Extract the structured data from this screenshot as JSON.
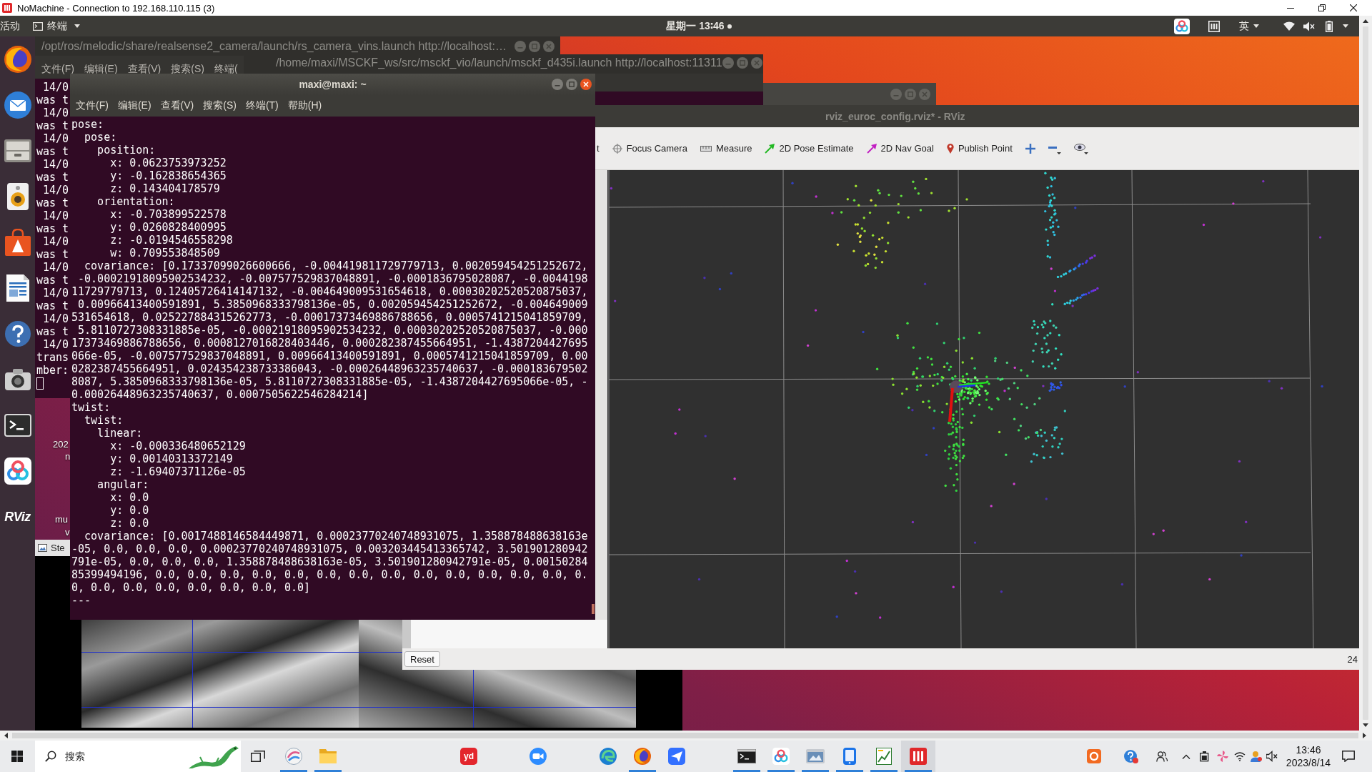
{
  "nomachine": {
    "title": "NoMachine - Connection to 192.168.110.115 (3)"
  },
  "top_bar": {
    "activities": "活动",
    "app_menu": "终端",
    "clock": "星期一 13∶46",
    "input_method": "英"
  },
  "dock": {
    "rviz_label": "RViz"
  },
  "desktop_labels": [
    "202",
    "n",
    "mu",
    "v"
  ],
  "launch_terminal": {
    "title": "/opt/ros/melodic/share/realsense2_camera/launch/rs_camera_vins.launch http://localhost:…",
    "menu": [
      "文件(F)",
      "编辑(E)",
      "查看(V)",
      "搜索(S)",
      "终端("
    ],
    "lines": [
      " 14/0",
      "was t",
      " 14/0",
      "was t",
      " 14/0",
      "was t",
      " 14/0",
      "was t",
      " 14/0",
      "was t",
      " 14/0",
      "was t",
      " 14/0",
      "was t",
      " 14/0",
      "was t",
      " 14/0",
      "was t",
      " 14/0",
      "was t",
      " 14/0",
      "trans",
      "mber:"
    ]
  },
  "msckf_terminal": {
    "title": "/home/maxi/MSCKF_ws/src/msckf_vio/launch/msckf_d435i.launch http://localhost:11311"
  },
  "image_window": {
    "title": "Ste"
  },
  "rviz": {
    "title": "rviz_euroc_config.rviz* - RViz",
    "tools": [
      {
        "kind": "interact",
        "label": "t"
      },
      {
        "kind": "focus",
        "label": "Focus Camera"
      },
      {
        "kind": "measure",
        "label": "Measure"
      },
      {
        "kind": "pose",
        "label": "2D Pose Estimate"
      },
      {
        "kind": "nav",
        "label": "2D Nav Goal"
      },
      {
        "kind": "point",
        "label": "Publish Point"
      },
      {
        "kind": "add"
      },
      {
        "kind": "remove"
      },
      {
        "kind": "view"
      }
    ],
    "reset": "Reset",
    "fps": "24"
  },
  "terminal": {
    "title": "maxi@maxi: ~",
    "menu": [
      "文件(F)",
      "编辑(E)",
      "查看(V)",
      "搜索(S)",
      "终端(T)",
      "帮助(H)"
    ],
    "lines": [
      "pose:",
      "  pose:",
      "    position:",
      "      x: 0.0623753973252",
      "      y: -0.162838654365",
      "      z: 0.143404178579",
      "    orientation:",
      "      x: -0.703899522578",
      "      y: 0.0260828400995",
      "      z: -0.0194546558298",
      "      w: 0.709553848509",
      "  covariance: [0.17337099026600666, -0.004419811729779713, 0.002059454251252672,",
      " -0.00021918095902534232, -0.007577529837048891, -0.0001836795028087, -0.0044198",
      "11729779713, 0.12405726414147132, -0.004649009531654618, 0.00030202520520875037,",
      " 0.00966413400591891, 5.3850968333798136e-05, 0.002059454251252672, -0.004649009",
      "531654618, 0.025227884315262773, -0.00017373469886788656, 0.0005741215041859709,",
      " 5.8110727308331885e-05, -0.00021918095902534232, 0.00030202520520875037, -0.000",
      "17373469886788656, 0.0008127016828403446, 0.000282387455664951, -1.4387204427695",
      "066e-05, -0.007577529837048891, 0.00966413400591891, 0.0005741215041859709, 0.00",
      "0282387455664951, 0.024354238733386043, -0.00026448963235740637, -0.000183679502",
      "8087, 5.3850968333798136e-05, 5.8110727308331885e-05, -1.4387204427695066e-05, -",
      "0.00026448963235740637, 0.0007505622546284214]",
      "twist:",
      "  twist:",
      "    linear:",
      "      x: -0.000336480652129",
      "      y: 0.00140313372149",
      "      z: -1.69407371126e-05",
      "    angular:",
      "      x: 0.0",
      "      y: 0.0",
      "      z: 0.0",
      "  covariance: [0.0017488146584449871, 0.00023770240748931075, 1.358878488638163e",
      "-05, 0.0, 0.0, 0.0, 0.00023770240748931075, 0.003203445413365742, 3.501901280942",
      "791e-05, 0.0, 0.0, 0.0, 1.358878488638163e-05, 3.501901280942791e-05, 0.00150284",
      "85399494196, 0.0, 0.0, 0.0, 0.0, 0.0, 0.0, 0.0, 0.0, 0.0, 0.0, 0.0, 0.0, 0.0, 0.",
      "0, 0.0, 0.0, 0.0, 0.0, 0.0, 0.0, 0.0]",
      "---"
    ]
  },
  "taskbar": {
    "search_placeholder": "搜索",
    "apps": [
      {
        "kind": "sketch",
        "running": true,
        "selected": false
      },
      {
        "kind": "folder",
        "running": true,
        "selected": false
      },
      {
        "kind": "logo",
        "label": "yd",
        "running": false,
        "selected": false
      },
      {
        "kind": "camera",
        "running": false,
        "selected": false
      },
      {
        "kind": "swirl",
        "running": false,
        "selected": false
      },
      {
        "kind": "globe",
        "running": true,
        "selected": false
      },
      {
        "kind": "plane",
        "running": false,
        "selected": false
      },
      {
        "kind": "console",
        "running": true,
        "selected": false
      },
      {
        "kind": "rings",
        "running": true,
        "selected": false
      },
      {
        "kind": "window",
        "running": true,
        "selected": false
      },
      {
        "kind": "phone",
        "running": true,
        "selected": false
      },
      {
        "kind": "chart",
        "running": true,
        "selected": false
      },
      {
        "kind": "bars",
        "running": true,
        "selected": true
      }
    ],
    "time": "13:46",
    "date": "2023/8/14"
  }
}
